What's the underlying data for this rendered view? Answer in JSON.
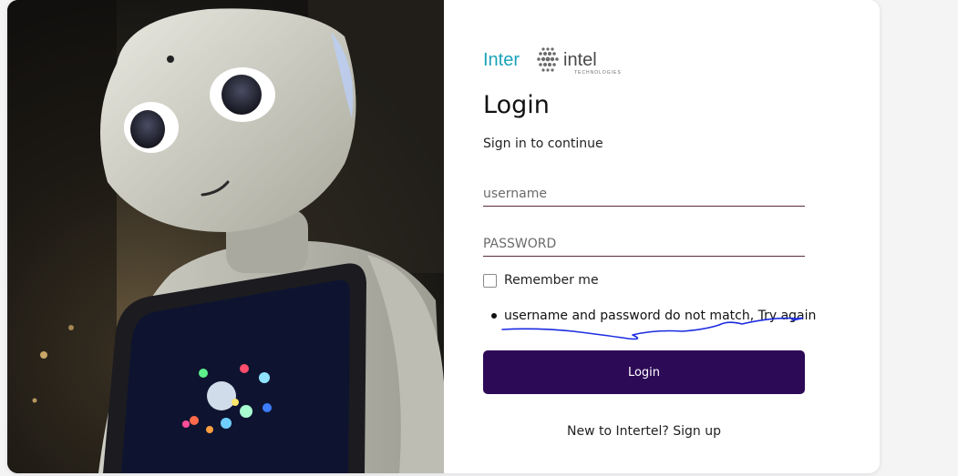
{
  "brand": {
    "logo_left": "Inter",
    "logo_right": "intel",
    "logo_tagline": "TECHNOLOGIES",
    "accent_color": "#1aa3b8",
    "primary_color": "#2d0a56"
  },
  "login": {
    "title": "Login",
    "subtitle": "Sign in to continue",
    "username_placeholder": "username",
    "password_placeholder": "PASSWORD",
    "remember_label": "Remember me",
    "remember_checked": false,
    "error_message": "username and password do not match, Try again",
    "submit_label": "Login",
    "signup_prompt": "New to Intertel?",
    "signup_link": "Sign up"
  },
  "hero": {
    "image_description_icon": "robot-photo"
  }
}
